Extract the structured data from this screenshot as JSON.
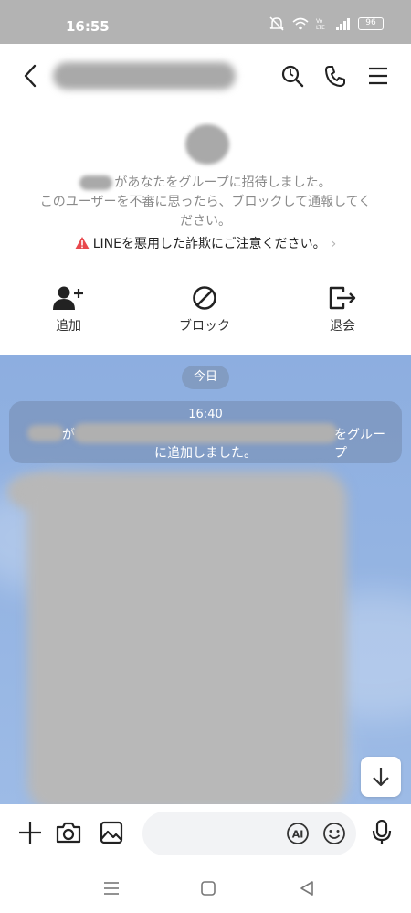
{
  "status_bar": {
    "time": "16:55",
    "battery": "96"
  },
  "header": {
    "icons": [
      "back-icon",
      "search-icon",
      "phone-icon",
      "menu-icon"
    ]
  },
  "invite": {
    "line1_suffix": "があなたをグループに招待しました。",
    "line2": "このユーザーを不審に思ったら、ブロックして通報してく",
    "line3": "ださい。",
    "warning": "LINEを悪用した詐欺にご注意ください。",
    "warning_color": "#e8474c",
    "actions": [
      {
        "label": "追加",
        "icon": "add-friend-icon"
      },
      {
        "label": "ブロック",
        "icon": "block-icon"
      },
      {
        "label": "退会",
        "icon": "leave-icon"
      }
    ]
  },
  "chat": {
    "date_label": "今日",
    "system_message": {
      "time": "16:40",
      "connector": "が",
      "suffix": "をグループ",
      "line2": "に追加しました。"
    },
    "background_color": "#8daee0"
  },
  "input_bar": {
    "message_value": "",
    "icons": [
      "plus-icon",
      "camera-icon",
      "image-icon",
      "ai-icon",
      "emoji-icon",
      "mic-icon"
    ]
  },
  "nav_bar": {
    "icons": [
      "recents-icon",
      "home-icon",
      "back-nav-icon"
    ]
  }
}
